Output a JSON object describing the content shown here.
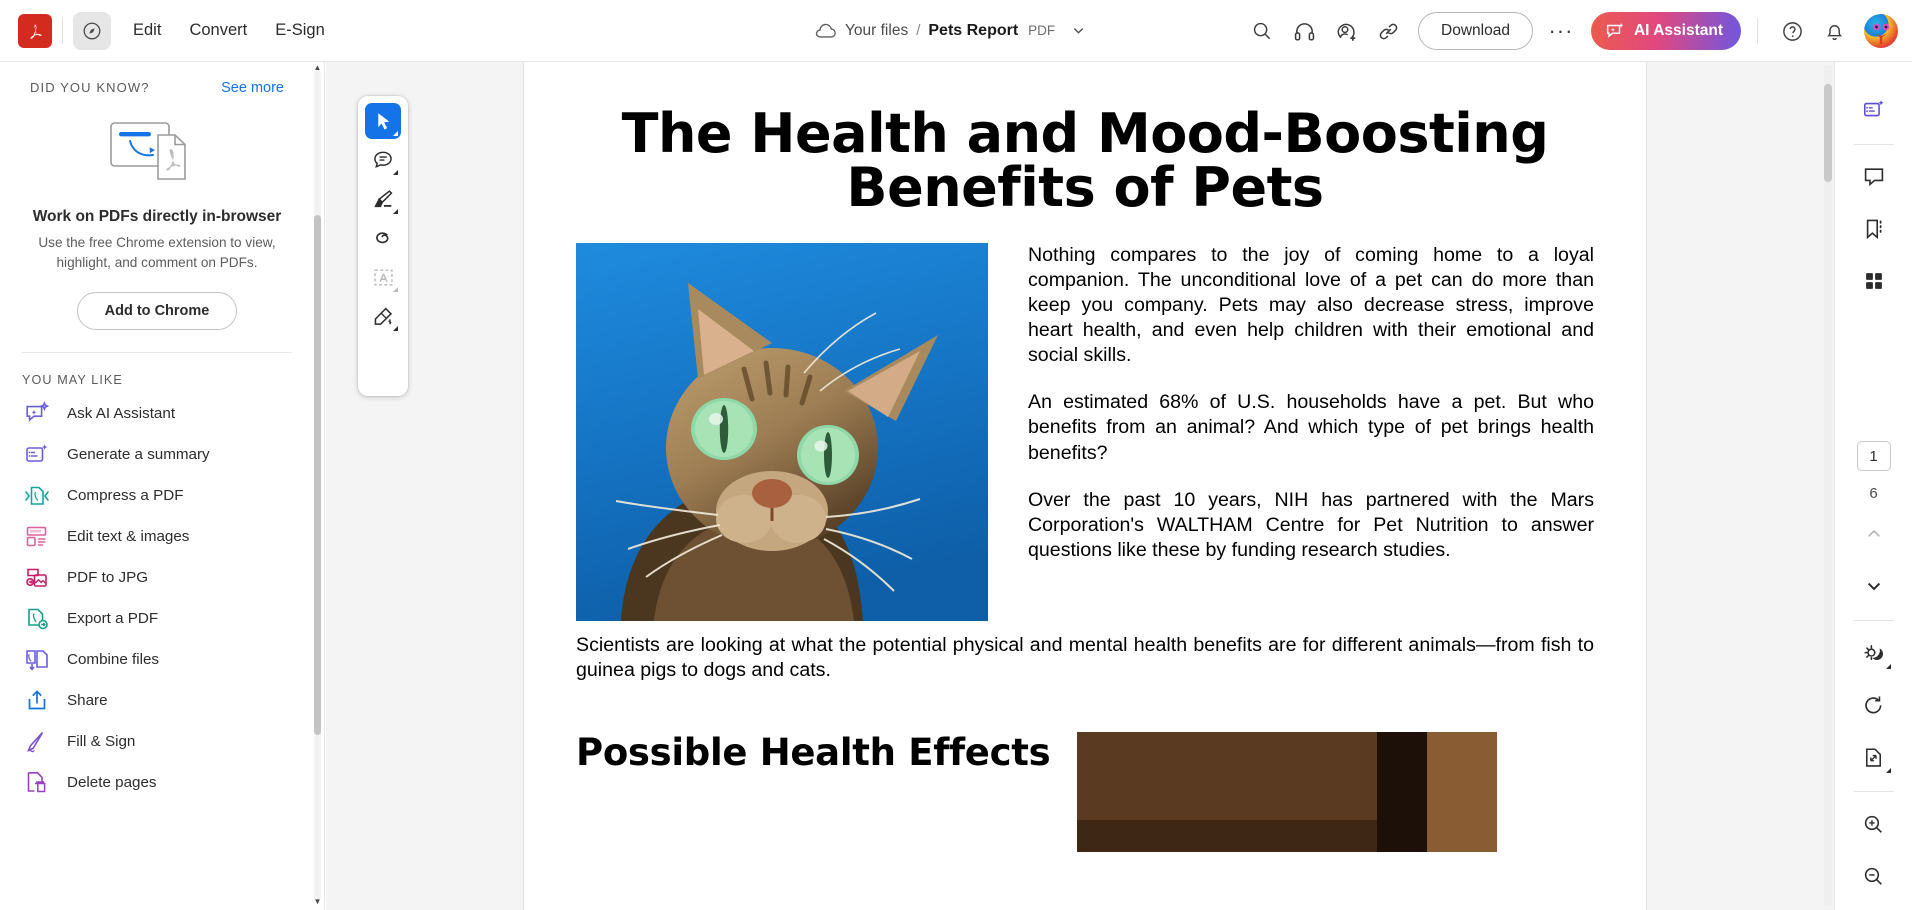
{
  "app": {
    "name": "Adobe Acrobat",
    "logo_icon": "adobe-acrobat-logo"
  },
  "topbar": {
    "view_tool_icon": "select-view-icon",
    "menus": [
      {
        "label": "Edit",
        "name": "menu-edit"
      },
      {
        "label": "Convert",
        "name": "menu-convert"
      },
      {
        "label": "E-Sign",
        "name": "menu-esign"
      }
    ],
    "breadcrumb": {
      "cloud_icon": "cloud-icon",
      "folder": "Your files",
      "separator": "/",
      "file": "Pets Report",
      "filetype": "PDF",
      "chevron_icon": "chevron-down-icon"
    },
    "actions": [
      {
        "name": "search-icon",
        "label": "Search"
      },
      {
        "name": "listen-headphones-icon",
        "label": "Listen"
      },
      {
        "name": "add-person-icon",
        "label": "Invite people"
      },
      {
        "name": "link-icon",
        "label": "Copy link"
      }
    ],
    "download_label": "Download",
    "more_label": "···",
    "ai_assistant_label": "AI Assistant",
    "help_icon": "help-question-icon",
    "notifications_icon": "bell-icon",
    "avatar_name": "user-avatar"
  },
  "sidebar": {
    "promo": {
      "eyebrow": "DID YOU KNOW?",
      "see_more": "See more",
      "art_icon": "browser-to-pdf-illustration",
      "title": "Work on PDFs directly in-browser",
      "subtitle": "Use the free Chrome extension to view, highlight, and comment on PDFs.",
      "cta": "Add to Chrome"
    },
    "you_may_like_label": "YOU MAY LIKE",
    "items": [
      {
        "label": "Ask AI Assistant",
        "icon": "ai-chat-sparkle-icon",
        "color": "#6a5ce0"
      },
      {
        "label": "Generate a summary",
        "icon": "summary-sparkle-icon",
        "color": "#6a5ce0"
      },
      {
        "label": "Compress a PDF",
        "icon": "compress-pdf-icon",
        "color": "#13a4a0"
      },
      {
        "label": "Edit text & images",
        "icon": "edit-text-images-icon",
        "color": "#e0609c"
      },
      {
        "label": "PDF to JPG",
        "icon": "pdf-to-jpg-icon",
        "color": "#c41d67"
      },
      {
        "label": "Export a PDF",
        "icon": "export-pdf-icon",
        "color": "#14a08a"
      },
      {
        "label": "Combine files",
        "icon": "combine-files-icon",
        "color": "#6a5ce0"
      },
      {
        "label": "Share",
        "icon": "share-upload-icon",
        "color": "#1473e6"
      },
      {
        "label": "Fill & Sign",
        "icon": "fill-sign-pen-icon",
        "color": "#7a52d6"
      },
      {
        "label": "Delete pages",
        "icon": "delete-pages-icon",
        "color": "#9b3fc4"
      }
    ]
  },
  "floating_toolbar": {
    "tools": [
      {
        "name": "select-cursor-tool",
        "icon": "cursor-arrow-icon",
        "state": "active"
      },
      {
        "name": "add-comment-tool",
        "icon": "comment-bubble-icon",
        "state": "normal"
      },
      {
        "name": "highlight-tool",
        "icon": "highlighter-icon",
        "state": "normal"
      },
      {
        "name": "draw-tool",
        "icon": "lasso-loop-icon",
        "state": "normal"
      },
      {
        "name": "add-text-tool",
        "icon": "text-box-icon",
        "state": "disabled"
      },
      {
        "name": "sign-tool",
        "icon": "fountain-pen-icon",
        "state": "normal"
      }
    ]
  },
  "right_rail": {
    "top_tools": [
      {
        "name": "ai-summary-panel",
        "icon": "summary-sparkle-icon"
      },
      {
        "name": "comments-panel",
        "icon": "comment-bubble-icon"
      },
      {
        "name": "bookmarks-panel",
        "icon": "bookmark-icon"
      },
      {
        "name": "thumbnails-panel",
        "icon": "grid-thumbnails-icon"
      }
    ],
    "page_current": "1",
    "page_total": "6",
    "prev_page_icon": "chevron-up-icon",
    "next_page_icon": "chevron-down-icon",
    "bottom_tools": [
      {
        "name": "display-mode-toggle",
        "icon": "sun-moon-icon"
      },
      {
        "name": "rotate-page",
        "icon": "rotate-clockwise-icon"
      },
      {
        "name": "fit-page",
        "icon": "fit-page-icon"
      },
      {
        "name": "zoom-in",
        "icon": "zoom-in-icon"
      },
      {
        "name": "zoom-out",
        "icon": "zoom-out-icon"
      }
    ]
  },
  "document": {
    "title": "The Health and Mood-Boosting Benefits of Pets",
    "hero_image_alt": "tabby-cat-on-blue-background",
    "paragraphs": [
      "Nothing compares to the joy of coming home to a loyal companion. The unconditional love of a pet can do more than keep you company. Pets may also decrease stress, improve heart health, and even help children with their emotional and social skills.",
      "An estimated 68% of U.S. households have a pet. But who benefits from an animal? And which type of pet brings health benefits?",
      "Over the past 10 years, NIH has partnered with the Mars Corporation's WALTHAM Centre for Pet Nutrition to answer questions like these by funding research studies."
    ],
    "wide_paragraph": "Scientists are looking at what the potential physical and mental health benefits are for different animals—from fish to guinea pigs to dogs and cats.",
    "section_heading": "Possible Health Effects",
    "secondary_image_alt": "dog-photo"
  }
}
